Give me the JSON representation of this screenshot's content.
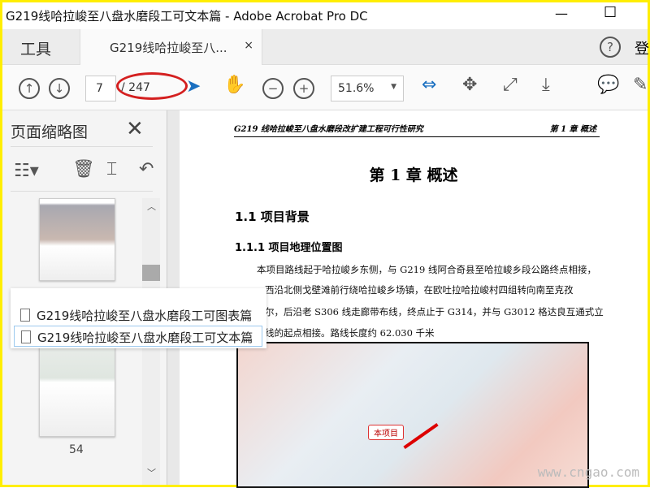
{
  "window": {
    "title": "G219线哈拉峻至八盘水磨段工可文本篇 - Adobe Acrobat Pro DC",
    "minimize": "—",
    "maximize": "☐"
  },
  "tabs": {
    "tools": "工具",
    "doc": "G219线哈拉峻至八...",
    "close": "×",
    "help": "?",
    "login": "登"
  },
  "toolbar": {
    "page_current": "7",
    "page_total": "/ 247",
    "zoom": "51.6%"
  },
  "left_panel": {
    "title": "页面缩略图",
    "close": "✕",
    "page_label": "54"
  },
  "popup": {
    "items": [
      "G219线哈拉峻至八盘水磨段工可图表篇",
      "G219线哈拉峻至八盘水磨段工可文本篇"
    ]
  },
  "document": {
    "header_left": "G219 线哈拉峻至八盘水磨段改扩建工程可行性研究",
    "header_right": "第 1 章  概述",
    "chapter": "第 1 章  概述",
    "h2": "1.1  项目背景",
    "h3": "1.1.1  项目地理位置图",
    "para": [
      "本项目路线起于哈拉峻乡东侧，与 G219 线阿合奇县至哈拉峻乡段公路终点相接，",
      "西沿北侧戈壁滩前行绕哈拉峻乡场镇，在欧吐拉哈拉峻村四组转向南至克孜",
      "尔，后沿老 S306 线走廊带布线，终点止于 G314，并与 G3012 格达良互通式立",
      "线的起点相接。路线长度约 62.030 千米"
    ],
    "map_label": "本项目"
  },
  "watermark": "www.cngao.com"
}
